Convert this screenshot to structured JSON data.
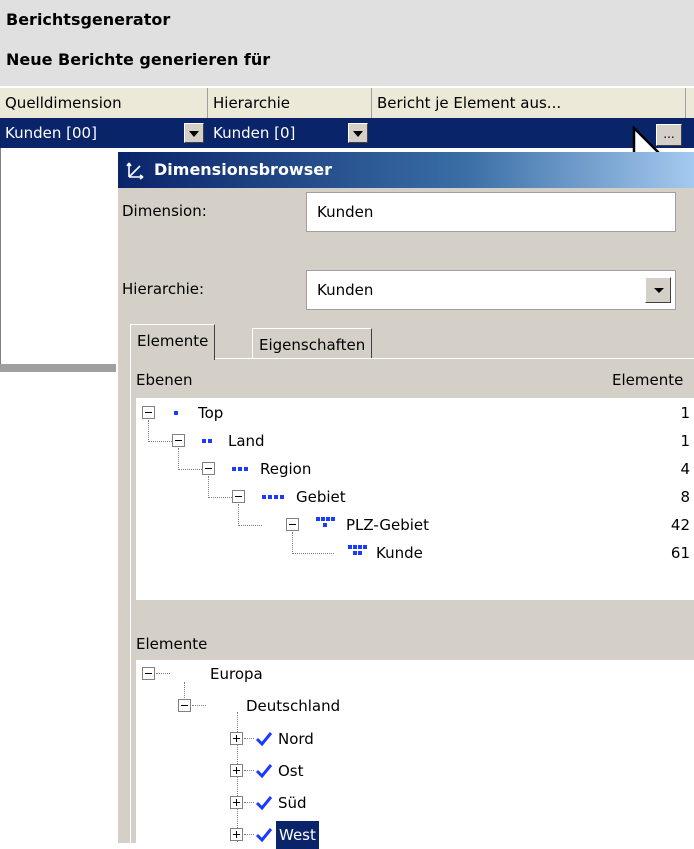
{
  "window": {
    "title": "Berichtsgenerator",
    "subtitle": "Neue Berichte generieren für"
  },
  "grid": {
    "columns": [
      "Quelldimension",
      "Hierarchie",
      "Bericht je Element aus..."
    ],
    "row": {
      "quelldimension": "Kunden [00]",
      "hierarchie": "Kunden [0]",
      "ellipsis_label": "..."
    }
  },
  "dialog": {
    "title": "Dimensionsbrowser",
    "dimension_label": "Dimension:",
    "dimension_value": "Kunden",
    "hierarchy_label": "Hierarchie:",
    "hierarchy_value": "Kunden",
    "tabs": [
      "Elemente",
      "Eigenschaften"
    ],
    "active_tab": "Elemente",
    "levels_header": "Ebenen",
    "levels_count_header": "Elemente",
    "levels": [
      {
        "name": "Top",
        "count": "1"
      },
      {
        "name": "Land",
        "count": "1"
      },
      {
        "name": "Region",
        "count": "4"
      },
      {
        "name": "Gebiet",
        "count": "8"
      },
      {
        "name": "PLZ-Gebiet",
        "count": "42"
      },
      {
        "name": "Kunde",
        "count": "61"
      }
    ],
    "elements_header": "Elemente",
    "elements": [
      {
        "name": "Europa"
      },
      {
        "name": "Deutschland"
      },
      {
        "name": "Nord",
        "checked": true
      },
      {
        "name": "Ost",
        "checked": true
      },
      {
        "name": "Süd",
        "checked": true
      },
      {
        "name": "West",
        "checked": true,
        "selected": true
      }
    ]
  },
  "icons": {
    "level_icon": "level-dots-icon",
    "check_icon": "check-icon",
    "dialog_icon": "dimension-browser-icon"
  },
  "colors": {
    "selection": "#0a246a",
    "level_icon": "#1a3cff",
    "checkmark": "#1a3cff"
  }
}
